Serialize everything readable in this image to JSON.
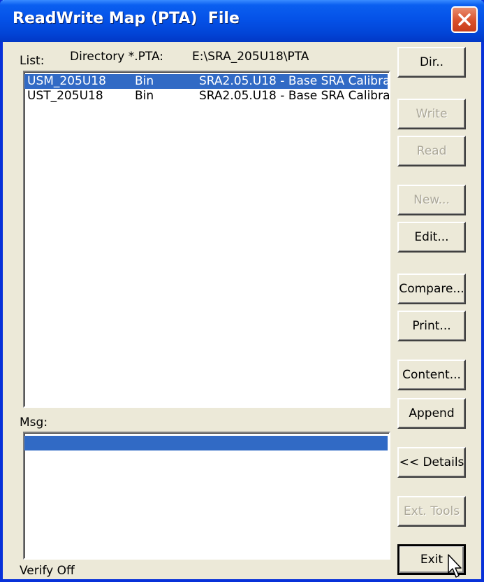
{
  "window": {
    "title": "ReadWrite Map (PTA)  File"
  },
  "icons": {
    "close": "close-x-icon",
    "cursor": "arrow-cursor-icon"
  },
  "header": {
    "list_label": "List:",
    "directory_label": "Directory *.PTA:",
    "directory_path": "E:\\SRA_205U18\\PTA"
  },
  "list": {
    "items": [
      {
        "name": "USM_205U18",
        "type": "Bin",
        "description": "SRA2.05.U18 - Base SRA Calibra",
        "selected": true
      },
      {
        "name": "UST_205U18",
        "type": "Bin",
        "description": "SRA2.05.U18 - Base SRA Calibra",
        "selected": false
      }
    ]
  },
  "msg": {
    "label": "Msg:"
  },
  "status": {
    "text": "Verify Off"
  },
  "buttons": {
    "dir": "Dir..",
    "write": "Write",
    "read": "Read",
    "new": "New...",
    "edit": "Edit...",
    "compare": "Compare...",
    "print": "Print...",
    "content": "Content...",
    "append": "Append",
    "details": "<< Details",
    "ext_tools": "Ext. Tools",
    "exit": "Exit"
  },
  "colors": {
    "selection": "#316ac5",
    "titlebar": "#0552e8",
    "dialog_face": "#ece9d8",
    "disabled_text": "#aca899"
  }
}
